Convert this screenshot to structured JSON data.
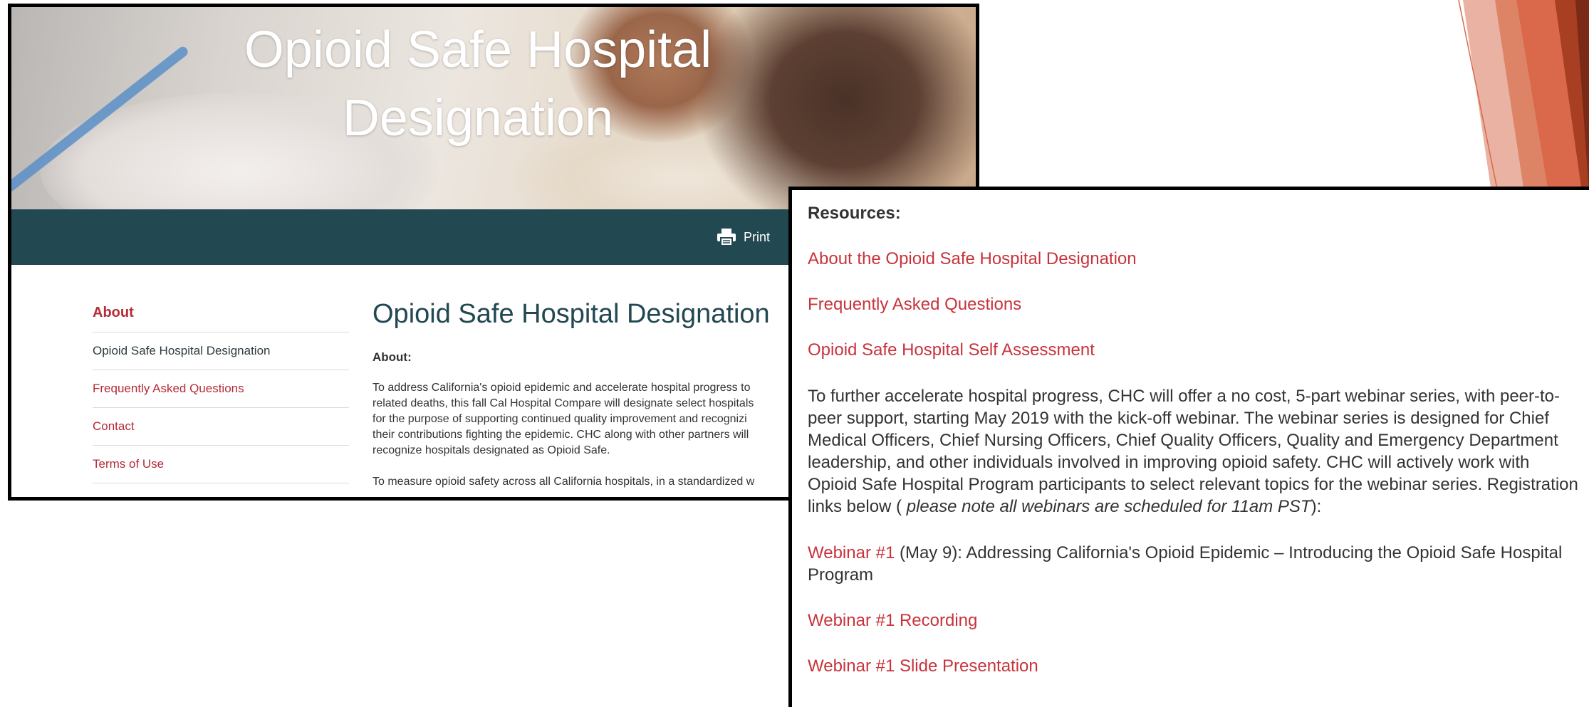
{
  "hero": {
    "title": "Opioid Safe Hospital Designation"
  },
  "toolbar": {
    "print_label": "Print"
  },
  "sidebar": {
    "heading": "About",
    "items": [
      {
        "label": "Opioid Safe Hospital Designation"
      },
      {
        "label": "Frequently Asked Questions"
      },
      {
        "label": "Contact"
      },
      {
        "label": "Terms of Use"
      }
    ]
  },
  "main": {
    "title": "Opioid Safe Hospital Designation",
    "about_label": "About:",
    "para1": "To address California's opioid epidemic and accelerate hospital progress to\nrelated deaths, this fall Cal Hospital Compare will designate select hospitals\nfor the purpose of supporting continued quality improvement and recognizi\ntheir contributions fighting the epidemic. CHC along with other partners will\nrecognize hospitals designated as Opioid Safe.",
    "para2": "To measure opioid safety across all California hospitals, in a standardized w"
  },
  "resources": {
    "heading": "Resources:",
    "links": [
      "About the Opioid Safe Hospital Designation",
      "Frequently Asked Questions",
      "Opioid Safe Hospital Self Assessment"
    ],
    "para_main": "To further accelerate hospital progress, CHC will offer a no cost, 5-part webinar series, with peer-to-peer support, starting May 2019 with the kick-off webinar. The webinar series is designed for Chief Medical Officers, Chief Nursing Officers, Chief Quality Officers, Quality and Emergency Department leadership, and other individuals involved in improving opioid safety. CHC will actively work with Opioid Safe Hospital Program participants to select relevant topics for the webinar series. Registration links below (",
    "para_italic": " please note all webinars are scheduled for 11am PST",
    "para_end": "):",
    "webinar1_link": "Webinar #1",
    "webinar1_text": " (May 9): Addressing California's Opioid Epidemic – Introducing the Opioid Safe Hospital Program",
    "recording_link": "Webinar #1 Recording",
    "slides_link": "Webinar #1 Slide Presentation"
  },
  "colors": {
    "accent_red": "#c8333b",
    "toolbar_teal": "#224852",
    "deco_orange": "#d9694a"
  }
}
